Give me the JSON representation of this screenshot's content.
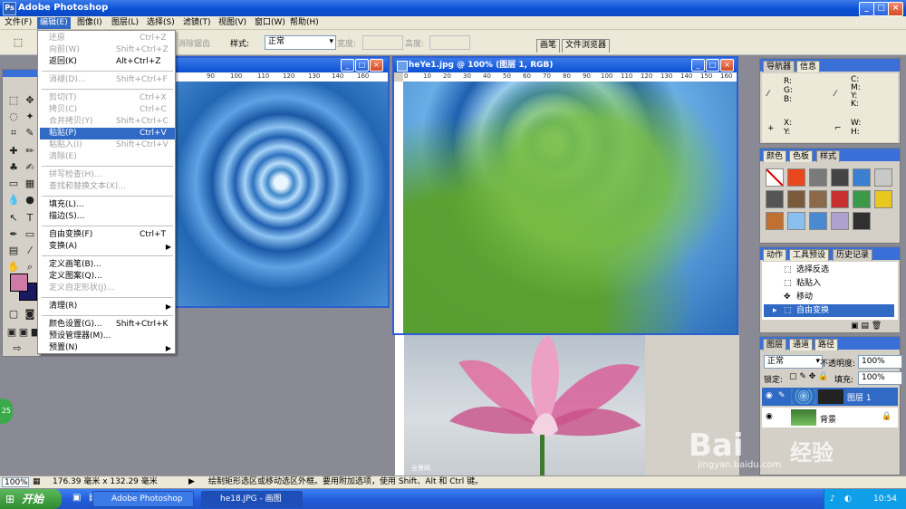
{
  "app": {
    "title": "Adobe Photoshop"
  },
  "menubar": [
    "文件(F)",
    "编辑(E)",
    "图像(I)",
    "图层(L)",
    "选择(S)",
    "滤镜(T)",
    "视图(V)",
    "窗口(W)",
    "帮助(H)"
  ],
  "options": {
    "antialias_label": "消除锯齿",
    "style_label": "样式:",
    "style_value": "正常",
    "width_label": "宽度:",
    "height_label": "高度:",
    "tab_brush": "画笔",
    "tab_browser": "文件浏览器"
  },
  "edit_menu": {
    "items": [
      {
        "label": "还原",
        "shortcut": "Ctrl+Z",
        "state": "disabled"
      },
      {
        "label": "向前(W)",
        "shortcut": "Shift+Ctrl+Z",
        "state": "disabled"
      },
      {
        "label": "返回(K)",
        "shortcut": "Alt+Ctrl+Z",
        "state": "normal"
      },
      {
        "label": "消褪(D)...",
        "shortcut": "Shift+Ctrl+F",
        "state": "disabled"
      },
      {
        "label": "剪切(T)",
        "shortcut": "Ctrl+X",
        "state": "disabled"
      },
      {
        "label": "拷贝(C)",
        "shortcut": "Ctrl+C",
        "state": "disabled"
      },
      {
        "label": "合并拷贝(Y)",
        "shortcut": "Shift+Ctrl+C",
        "state": "disabled"
      },
      {
        "label": "粘贴(P)",
        "shortcut": "Ctrl+V",
        "state": "highlighted"
      },
      {
        "label": "粘贴入(I)",
        "shortcut": "Shift+Ctrl+V",
        "state": "disabled"
      },
      {
        "label": "清除(E)",
        "shortcut": "",
        "state": "disabled"
      },
      {
        "label": "拼写检查(H)...",
        "shortcut": "",
        "state": "disabled"
      },
      {
        "label": "查找和替换文本(X)...",
        "shortcut": "",
        "state": "disabled"
      },
      {
        "label": "填充(L)...",
        "shortcut": "",
        "state": "normal"
      },
      {
        "label": "描边(S)...",
        "shortcut": "",
        "state": "normal"
      },
      {
        "label": "自由变换(F)",
        "shortcut": "Ctrl+T",
        "state": "normal"
      },
      {
        "label": "变换(A)",
        "shortcut": "",
        "state": "normal",
        "submenu": true
      },
      {
        "label": "定义画笔(B)...",
        "shortcut": "",
        "state": "normal"
      },
      {
        "label": "定义图案(Q)...",
        "shortcut": "",
        "state": "normal"
      },
      {
        "label": "定义自定形状(J)...",
        "shortcut": "",
        "state": "disabled"
      },
      {
        "label": "清理(R)",
        "shortcut": "",
        "state": "normal",
        "submenu": true
      },
      {
        "label": "颜色设置(G)...",
        "shortcut": "Shift+Ctrl+K",
        "state": "normal"
      },
      {
        "label": "预设管理器(M)...",
        "shortcut": "",
        "state": "normal"
      },
      {
        "label": "预置(N)",
        "shortcut": "",
        "state": "normal",
        "submenu": true
      }
    ]
  },
  "docs": {
    "doc2_title": "heYe1.jpg @ 100% (图层 1, RGB)",
    "ruler_ticks": [
      "0",
      "10",
      "20",
      "30",
      "40",
      "50",
      "60",
      "70",
      "80",
      "90",
      "100",
      "110",
      "120",
      "130",
      "140",
      "150",
      "160"
    ],
    "doc1_ticks": [
      "90",
      "100",
      "110",
      "120",
      "130",
      "140",
      "150",
      "160"
    ],
    "lotus_watermark": "全景网"
  },
  "navigator": {
    "tab1": "导航器",
    "tab2": "信息",
    "r": "R:",
    "g": "G:",
    "b": "B:",
    "c": "C:",
    "m": "M:",
    "y": "Y:",
    "k": "K:",
    "x": "X:",
    "ycoord": "Y:",
    "w": "W:",
    "h": "H:"
  },
  "swatches_panel": {
    "tab1": "颜色",
    "tab2": "色板",
    "tab3": "样式",
    "colors": [
      "#ffffff",
      "#e8481c",
      "#7a7a7a",
      "#444444",
      "#3a7fd0",
      "#c8c8c8",
      "#555555",
      "#7a5a3a",
      "#8a6a4a",
      "#c83030",
      "#3a9a4a",
      "#e8c820",
      "#c07030",
      "#8ac0f0",
      "#4a8ad0",
      "#b0a0d0",
      "#303030"
    ]
  },
  "history": {
    "tab1": "动作",
    "tab2": "工具预设",
    "tab3": "历史记录",
    "items": [
      "选择反选",
      "粘贴入",
      "移动",
      "自由变换"
    ]
  },
  "layers": {
    "tab1": "图层",
    "tab2": "通道",
    "tab3": "路径",
    "blend": "正常",
    "opacity_label": "不透明度:",
    "opacity": "100%",
    "lock_label": "锁定:",
    "fill_label": "填充:",
    "fill": "100%",
    "layer1": "图层 1",
    "background": "背景"
  },
  "status": {
    "zoom": "100%",
    "size": "176.39 毫米 x 132.29 毫米",
    "hint": "绘制矩形选区或移动选区外框。要用附加选项，使用 Shift、Alt 和 Ctrl 键。"
  },
  "taskbar": {
    "start": "开始",
    "item1": "Adobe Photoshop",
    "item2": "he18.JPG - 画图",
    "clock": "10:54"
  },
  "badge": "25",
  "watermark": {
    "brand": "Bai",
    "brand2": "经验",
    "url": "jingyan.baidu.com"
  },
  "colors": {
    "foreground": "#d07aa8",
    "background": "#1a1a60",
    "accent": "#316ac5"
  }
}
